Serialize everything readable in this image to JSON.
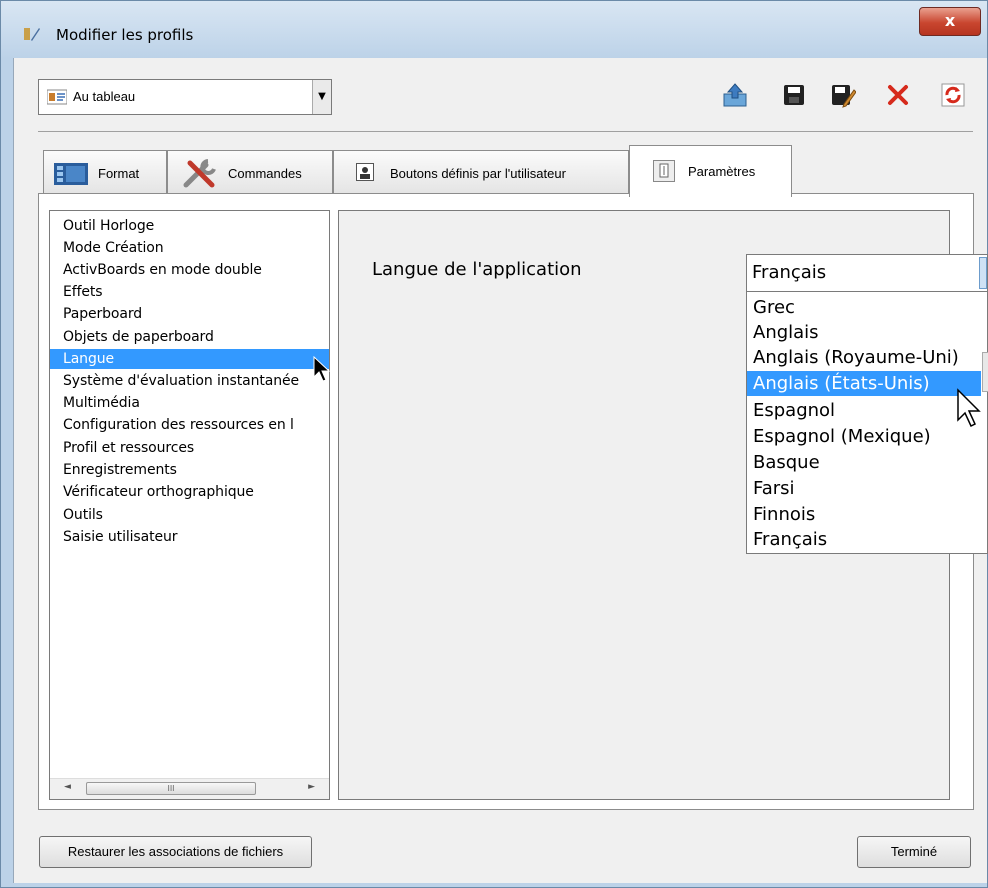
{
  "window": {
    "title": "Modifier les profils",
    "close_glyph": "x"
  },
  "profile_select": {
    "value": "Au tableau",
    "icon": "profile-board-icon"
  },
  "toolbar": [
    {
      "name": "export-icon"
    },
    {
      "name": "save-icon"
    },
    {
      "name": "save-as-icon"
    },
    {
      "name": "delete-icon"
    },
    {
      "name": "refresh-icon"
    }
  ],
  "tabs": [
    {
      "label": "Format",
      "icon": "format-icon"
    },
    {
      "label": "Commandes",
      "icon": "tools-icon"
    },
    {
      "label": "Boutons définis par l'utilisateur",
      "icon": "user-buttons-icon"
    },
    {
      "label": "Paramètres",
      "icon": "settings-icon",
      "active": true
    }
  ],
  "settings_list": {
    "items": [
      "Outil Horloge",
      "Mode Création",
      "ActivBoards en mode double",
      "Effets",
      "Paperboard",
      "Objets de paperboard",
      "Langue",
      "Système d'évaluation instantanée",
      "Multimédia",
      "Configuration des ressources en l",
      "Profil et ressources",
      "Enregistrements",
      "Vérificateur orthographique",
      "Outils",
      "Saisie utilisateur"
    ],
    "selected": "Langue",
    "scroll_thumb": "III"
  },
  "language": {
    "label": "Langue de l'application",
    "current": "Français",
    "options": [
      "Grec",
      "Anglais",
      "Anglais (Royaume-Uni)",
      "Anglais (États-Unis)",
      "Espagnol",
      "Espagnol (Mexique)",
      "Basque",
      "Farsi",
      "Finnois",
      "Français"
    ],
    "highlighted": "Anglais (États-Unis)"
  },
  "footer": {
    "restore_label": "Restaurer les associations de fichiers",
    "done_label": "Terminé"
  },
  "colors": {
    "selection": "#3399ff",
    "titlebar": "#bcd2e8",
    "close": "#c9462f"
  }
}
